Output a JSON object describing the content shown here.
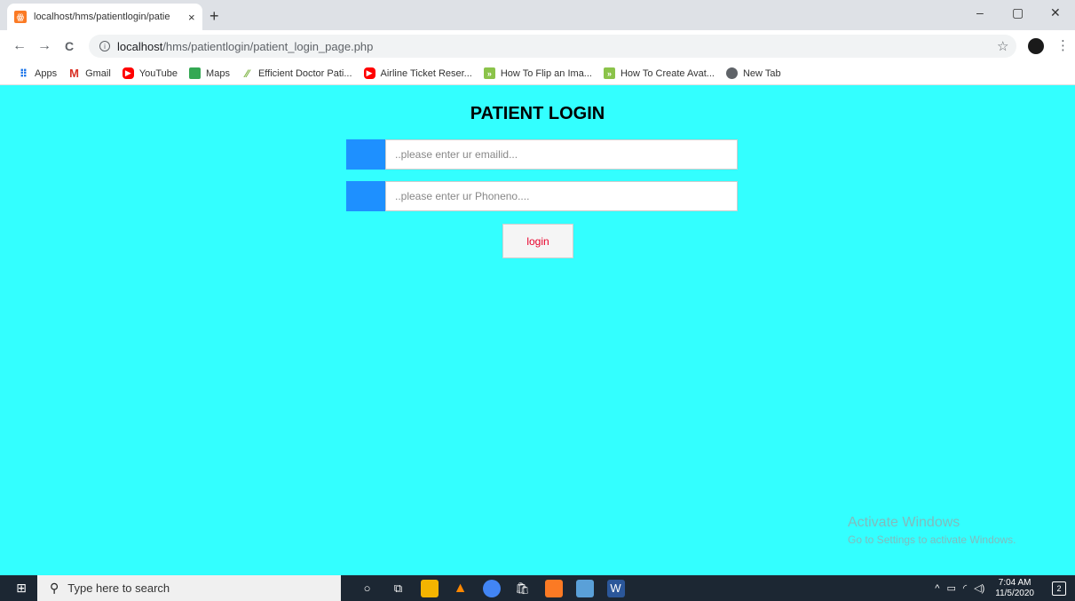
{
  "browser": {
    "tab_title": "localhost/hms/patientlogin/patie",
    "tab_close": "×",
    "new_tab": "+",
    "url_host": "localhost",
    "url_path": "/hms/patientlogin/patient_login_page.php",
    "window_controls": {
      "minimize": "–",
      "maximize": "▢",
      "close": "✕"
    },
    "nav": {
      "back": "←",
      "forward": "→",
      "reload": "C"
    },
    "bookmarks": [
      {
        "label": "Apps",
        "icon": "apps-icon"
      },
      {
        "label": "Gmail",
        "icon": "gmail-icon"
      },
      {
        "label": "YouTube",
        "icon": "youtube-icon"
      },
      {
        "label": "Maps",
        "icon": "maps-icon"
      },
      {
        "label": "Efficient Doctor Pati...",
        "icon": "leaf-icon"
      },
      {
        "label": "Airline Ticket Reser...",
        "icon": "youtube-icon"
      },
      {
        "label": "How To Flip an Ima...",
        "icon": "site-icon"
      },
      {
        "label": "How To Create Avat...",
        "icon": "site-icon"
      },
      {
        "label": "New Tab",
        "icon": "globe-icon"
      }
    ]
  },
  "page": {
    "title": "PATIENT LOGIN",
    "email_placeholder": "..please enter ur emailid...",
    "phone_placeholder": "..please enter ur Phoneno....",
    "login_label": "login",
    "watermark_line1": "Activate Windows",
    "watermark_line2": "Go to Settings to activate Windows.",
    "colors": {
      "background": "#33ffff",
      "addon": "#1e90ff",
      "login_text": "#e8002a"
    }
  },
  "taskbar": {
    "search_placeholder": "Type here to search",
    "time": "7:04 AM",
    "date": "11/5/2020",
    "notifications": "2",
    "pinned": [
      "cortana-icon",
      "task-view-icon",
      "file-explorer-icon",
      "vlc-icon",
      "chrome-icon",
      "store-icon",
      "xampp-icon",
      "virtualbox-icon",
      "word-icon"
    ]
  }
}
